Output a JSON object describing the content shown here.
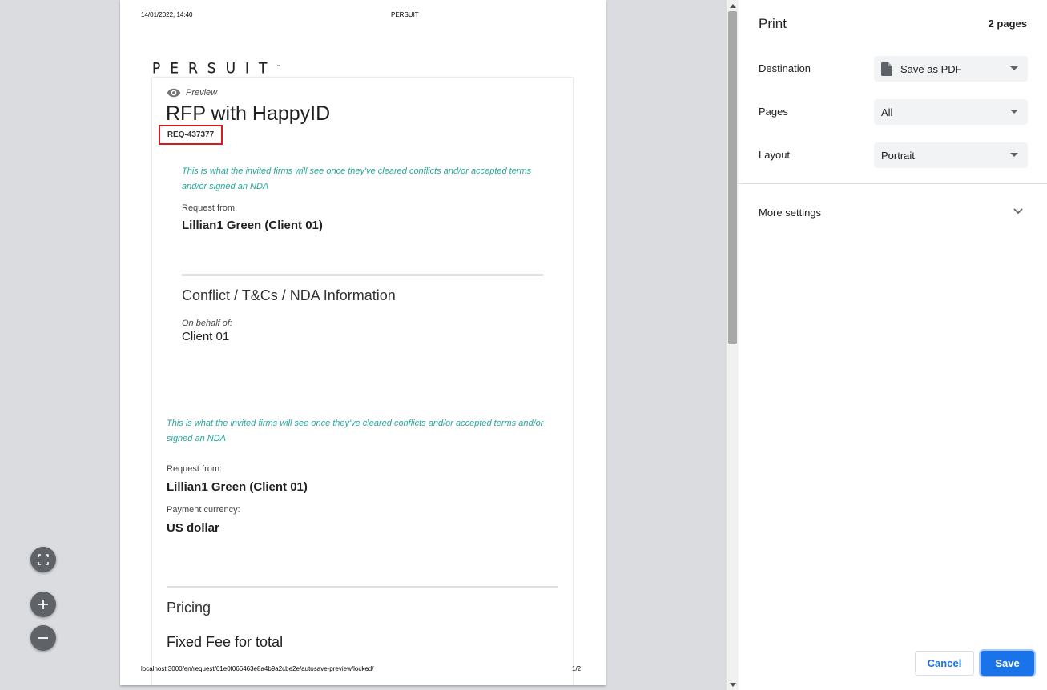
{
  "document": {
    "header_date": "14/01/2022, 14:40",
    "header_title": "PERSUIT",
    "footer_url": "localhost:3000/en/request/61e0f066463e8a4b9a2cbe2e/autosave-preview/locked/",
    "footer_page": "1/2",
    "logo_text": "PERSUIT",
    "logo_tm": "™",
    "preview_label": "Preview",
    "rfp_title": "RFP with HappyID",
    "req_id": "REQ-437377",
    "note_1": "This is what the invited firms will see once they've cleared conflicts and/or accepted terms and/or signed an NDA",
    "request_from_label_1": "Request from:",
    "request_from_value_1": "Lillian1 Green (Client 01)",
    "section_conflict": "Conflict / T&Cs / NDA Information",
    "on_behalf_label": "On behalf of:",
    "on_behalf_value": "Client 01",
    "note_2": "This is what the invited firms will see once they've cleared conflicts and/or accepted terms and/or signed an NDA",
    "request_from_label_2": "Request from:",
    "request_from_value_2": "Lillian1 Green (Client 01)",
    "payment_currency_label": "Payment currency:",
    "payment_currency_value": "US dollar",
    "section_pricing": "Pricing",
    "fixed_fee_title": "Fixed Fee for total"
  },
  "zoom_controls": {
    "fit_icon": "fit-to-page-icon",
    "zoom_in_icon": "zoom-in-icon",
    "zoom_out_icon": "zoom-out-icon"
  },
  "sidebar": {
    "title": "Print",
    "page_count": "2 pages",
    "destination_label": "Destination",
    "destination_value": "Save as PDF",
    "pages_label": "Pages",
    "pages_value": "All",
    "layout_label": "Layout",
    "layout_value": "Portrait",
    "more_settings_label": "More settings",
    "cancel_label": "Cancel",
    "save_label": "Save"
  },
  "colors": {
    "accent": "#1a73e8",
    "note_teal": "#26a69a",
    "highlight_red": "#d81b1b"
  }
}
